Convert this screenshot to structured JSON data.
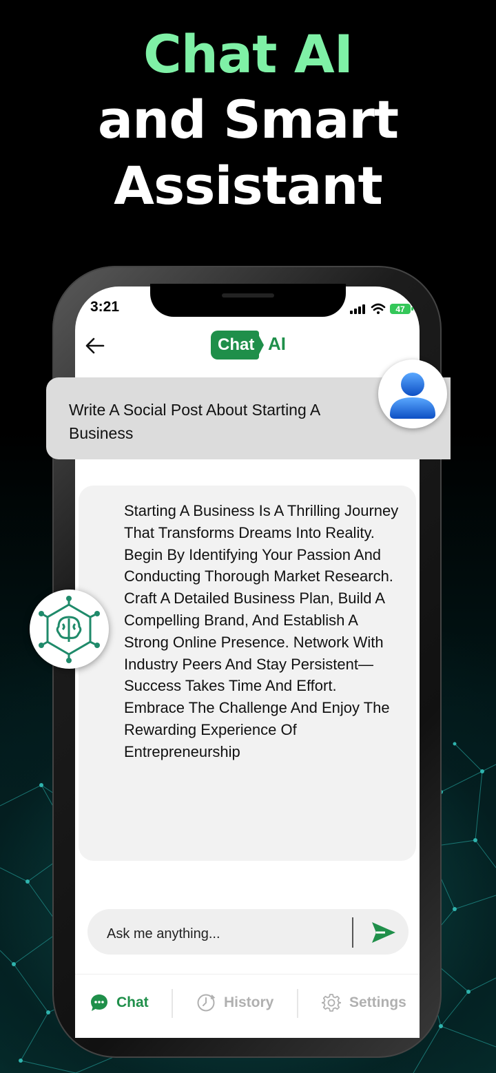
{
  "headline": {
    "line1": "Chat AI",
    "line2": "and Smart",
    "line3": "Assistant"
  },
  "status_bar": {
    "time": "3:21",
    "battery": "47"
  },
  "header": {
    "logo_chat": "Chat",
    "logo_ai": "AI"
  },
  "conversation": {
    "user_message": "Write A Social Post About Starting A Business",
    "ai_message": "Starting A Business Is A Thrilling Journey That Transforms Dreams Into Reality. Begin By Identifying Your Passion And Conducting Thorough Market Research. Craft A Detailed Business Plan, Build A Compelling Brand, And Establish A Strong Online Presence. Network With Industry Peers And Stay Persistent—Success Takes Time And Effort. Embrace The Challenge And Enjoy The Rewarding Experience Of Entrepreneurship"
  },
  "input": {
    "placeholder": "Ask me anything..."
  },
  "tabs": [
    {
      "label": "Chat",
      "icon": "chat-bubble-icon",
      "active": true
    },
    {
      "label": "History",
      "icon": "history-icon",
      "active": false
    },
    {
      "label": "Settings",
      "icon": "gear-icon",
      "active": false
    }
  ],
  "colors": {
    "accent": "#1f8f4a",
    "headline_green": "#7ff0a6",
    "inactive_tab": "#b0b0b0"
  }
}
